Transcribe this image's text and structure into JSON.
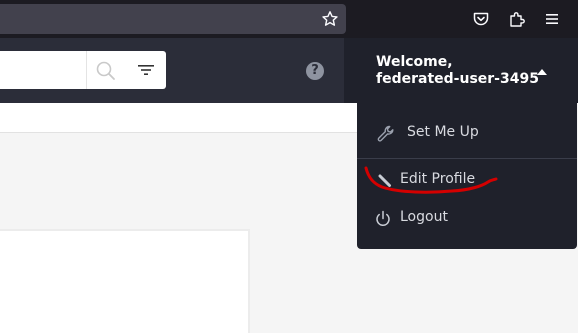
{
  "browser": {
    "star_icon": "bookmark-star-icon",
    "pocket_icon": "pocket-icon",
    "extensions_icon": "extensions-icon",
    "menu_icon": "hamburger-menu-icon"
  },
  "header": {
    "search_icon": "search-icon",
    "filter_icon": "filter-icon",
    "help_label": "?"
  },
  "user_menu": {
    "welcome": "Welcome,",
    "username": "federated-user-3495",
    "caret_icon": "caret-up-icon",
    "items": [
      {
        "label": "Set Me Up",
        "icon": "wrench-icon"
      },
      {
        "label": "Edit Profile",
        "icon": "pencil-icon"
      },
      {
        "label": "Logout",
        "icon": "power-icon"
      }
    ]
  },
  "colors": {
    "browser_bg": "#1c1b22",
    "header_bg": "#2b2d39",
    "menu_bg": "#1f212b",
    "annotation_red": "#d40000"
  }
}
